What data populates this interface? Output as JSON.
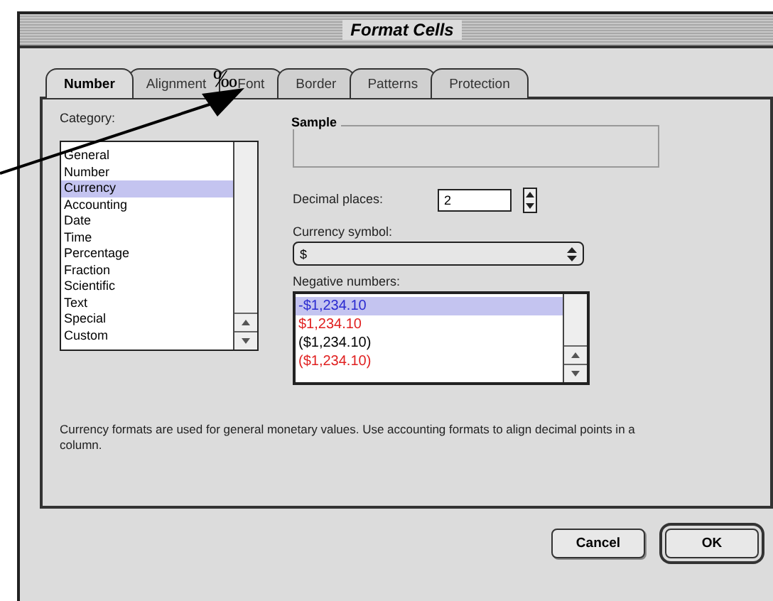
{
  "window": {
    "title": "Format Cells"
  },
  "tabs": [
    {
      "label": "Number",
      "selected": true
    },
    {
      "label": "Alignment",
      "selected": false
    },
    {
      "label": "Font",
      "selected": false
    },
    {
      "label": "Border",
      "selected": false
    },
    {
      "label": "Patterns",
      "selected": false
    },
    {
      "label": "Protection",
      "selected": false
    }
  ],
  "category": {
    "label": "Category:",
    "items": [
      {
        "label": "General",
        "selected": false
      },
      {
        "label": "Number",
        "selected": false
      },
      {
        "label": "Currency",
        "selected": true
      },
      {
        "label": "Accounting",
        "selected": false
      },
      {
        "label": "Date",
        "selected": false
      },
      {
        "label": "Time",
        "selected": false
      },
      {
        "label": "Percentage",
        "selected": false
      },
      {
        "label": "Fraction",
        "selected": false
      },
      {
        "label": "Scientific",
        "selected": false
      },
      {
        "label": "Text",
        "selected": false
      },
      {
        "label": "Special",
        "selected": false
      },
      {
        "label": "Custom",
        "selected": false
      }
    ]
  },
  "sample": {
    "label": "Sample"
  },
  "decimal_places": {
    "label": "Decimal places:",
    "value": "2"
  },
  "currency_symbol": {
    "label": "Currency symbol:",
    "value": "$"
  },
  "negative_numbers": {
    "label": "Negative numbers:",
    "items": [
      {
        "label": "-$1,234.10",
        "selected": true,
        "color": "#2a2ad0"
      },
      {
        "label": "$1,234.10",
        "selected": false,
        "color": "#e02020"
      },
      {
        "label": "($1,234.10)",
        "selected": false,
        "color": "#000000"
      },
      {
        "label": "($1,234.10)",
        "selected": false,
        "color": "#e02020"
      }
    ]
  },
  "description": "Currency formats are used for general monetary values. Use accounting formats to align decimal points in a column.",
  "buttons": [
    {
      "label": "Cancel",
      "default": false
    },
    {
      "label": "OK",
      "default": true
    }
  ],
  "annotation": {
    "label": "‰"
  }
}
